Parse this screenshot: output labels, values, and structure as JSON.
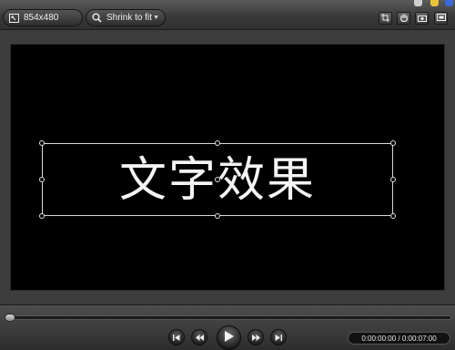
{
  "toolbar": {
    "dimensions_label": "854x480",
    "zoom_label": "Shrink to fit",
    "icons": [
      "crop-icon",
      "hand-pan-icon",
      "screenshot-icon",
      "fullscreen-icon"
    ]
  },
  "canvas": {
    "caption_text": "文字效果"
  },
  "playback": {
    "buttons": [
      "skip-to-start-icon",
      "rewind-icon",
      "play-icon",
      "fast-forward-icon",
      "skip-to-end-icon"
    ],
    "timecode": "0:00:00:00 / 0:00:07:00"
  },
  "colors": {
    "canvas_bg": "#000000",
    "chrome_bg": "#3a3a3a",
    "selection": "#d8d8d8"
  }
}
